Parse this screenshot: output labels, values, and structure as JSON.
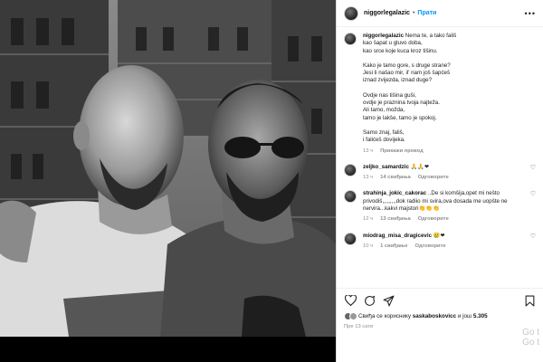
{
  "post": {
    "username": "niggorlegalazic",
    "follow_label": "Прати",
    "more_label": "•••"
  },
  "caption": {
    "username": "niggorlegalazic",
    "lines": [
      "Nema te, a tako fališ",
      "kao šapat u gluvo doba,",
      "kao srce koje kuca kroz tišinu.",
      "",
      "Kako je tamo gore, s druge strane?",
      "Jesi li našao mir, il' nam još šapćeš",
      "iznad zvijezda, iznad duge?",
      "",
      "Ovdje nas tišina guši,",
      "ovdje je praznina tvoja najteža.",
      "Ali tamo, možda,",
      "tamo je lakše, tamo je spokoj.",
      "",
      "Samo znaj, fališ,",
      "i falićeš dovijeka."
    ],
    "time": "13 ч",
    "translate_label": "Прикажи превод"
  },
  "comments": [
    {
      "username": "zeljko_samardzic",
      "text": "🙏🙏❤",
      "time": "13 ч",
      "likes": "14 свиђања",
      "reply": "Одговорите"
    },
    {
      "username": "strahinja_jokic_cakorac",
      "text": "..De si komšija,opet mi nešto privodiš,,,,,,,,,dok radiio mi svira,ova dosada me uopšte ne nervira...kakvi majstori👏👏👏",
      "time": "12 ч",
      "likes": "13 свиђања",
      "reply": "Одговорите"
    },
    {
      "username": "miodrag_misa_dragicevic",
      "text": "😢❤",
      "time": "10 ч",
      "likes": "1 свиђање",
      "reply": "Одговорите"
    }
  ],
  "likes": {
    "prefix": "Свиђа се кориснику",
    "user": "saskaboskovicc",
    "middle": "и још",
    "count": "5.305"
  },
  "post_time": "Пре 13 сати",
  "watermark": {
    "line1": "Go t",
    "line2": "Go t"
  }
}
